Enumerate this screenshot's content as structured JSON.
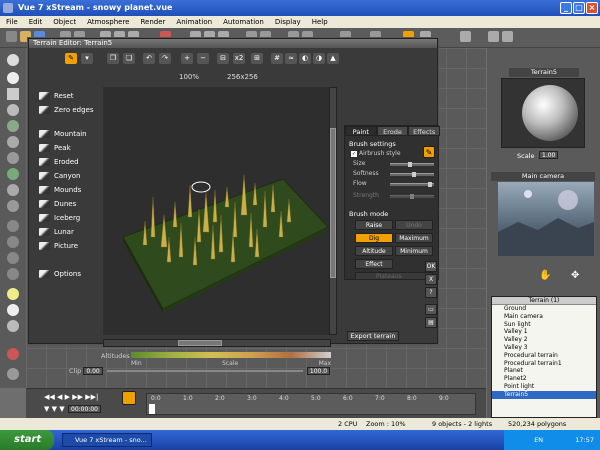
{
  "window": {
    "title": "Vue 7 xStream - snowy planet.vue"
  },
  "menu": [
    "File",
    "Edit",
    "Object",
    "Atmosphere",
    "Render",
    "Animation",
    "Automation",
    "Display",
    "Help"
  ],
  "editor": {
    "title": "Terrain Editor: Terrain5",
    "zoom": "100%",
    "resolution": "256x256",
    "zoom_factor": "x2",
    "left_items": [
      "Reset",
      "Zero edges",
      "Mountain",
      "Peak",
      "Eroded",
      "Canyon",
      "Mounds",
      "Dunes",
      "Iceberg",
      "Lunar",
      "Picture",
      "Options"
    ],
    "tabs": [
      "Paint",
      "Erode",
      "Effects"
    ],
    "brush_settings_label": "Brush settings",
    "airbrush_label": "Airbrush style",
    "airbrush_checked": true,
    "sliders": [
      {
        "label": "Size",
        "value": 0.45
      },
      {
        "label": "Softness",
        "value": 0.55
      },
      {
        "label": "Flow",
        "value": 0.95
      },
      {
        "label": "Strength",
        "value": 0.5
      }
    ],
    "brush_mode_label": "Brush mode",
    "modes": [
      {
        "label": "Raise",
        "state": "normal"
      },
      {
        "label": "Undo",
        "state": "disabled"
      },
      {
        "label": "Dig",
        "state": "active"
      },
      {
        "label": "Maximum",
        "state": "normal"
      },
      {
        "label": "Altitude",
        "state": "normal"
      },
      {
        "label": "Minimum",
        "state": "normal"
      },
      {
        "label": "Effect",
        "state": "normal"
      }
    ],
    "effect_dropdown": "Plateaus",
    "altitudes_label": "Altitudes",
    "gradient_min": "Min",
    "gradient_scale": "Scale",
    "gradient_max": "Max",
    "clip_label": "Clip",
    "clip_low": "0.00",
    "clip_high": "100.0",
    "export_button": "Export terrain",
    "side_buttons": [
      "OK",
      "X",
      "?"
    ]
  },
  "right": {
    "material_title": "Terrain5",
    "scale_label": "Scale",
    "scale_value": "1.00",
    "camera_title": "Main camera",
    "tree_header": "Terrain (1)",
    "tree_items": [
      "Ground",
      "Main camera",
      "Sun light",
      "Valley 1",
      "Valley 2",
      "Valley 3",
      "Procedural terrain",
      "Procedural terrain1",
      "Planet",
      "Planet2",
      "Point light",
      "Terrain5"
    ],
    "tree_selected": 11
  },
  "timeline": {
    "time": "00:00:00",
    "ticks": [
      "0:0",
      "1:0",
      "2:0",
      "3:0",
      "4:0",
      "5:0",
      "6:0",
      "7:0",
      "8:0",
      "9:0"
    ]
  },
  "status": {
    "cpu": "2 CPU",
    "zoom": "Zoom : 10%",
    "objects": "9 objects - 2 lights",
    "polygons": "520,234 polygons"
  },
  "taskbar": {
    "start": "start",
    "task": "Vue 7 xStream - sno...",
    "lang": "EN",
    "clock": "17:57"
  },
  "colors": {
    "accent": "#f0a000",
    "terrain": "#2f4a1c",
    "selection": "#316ac5"
  }
}
